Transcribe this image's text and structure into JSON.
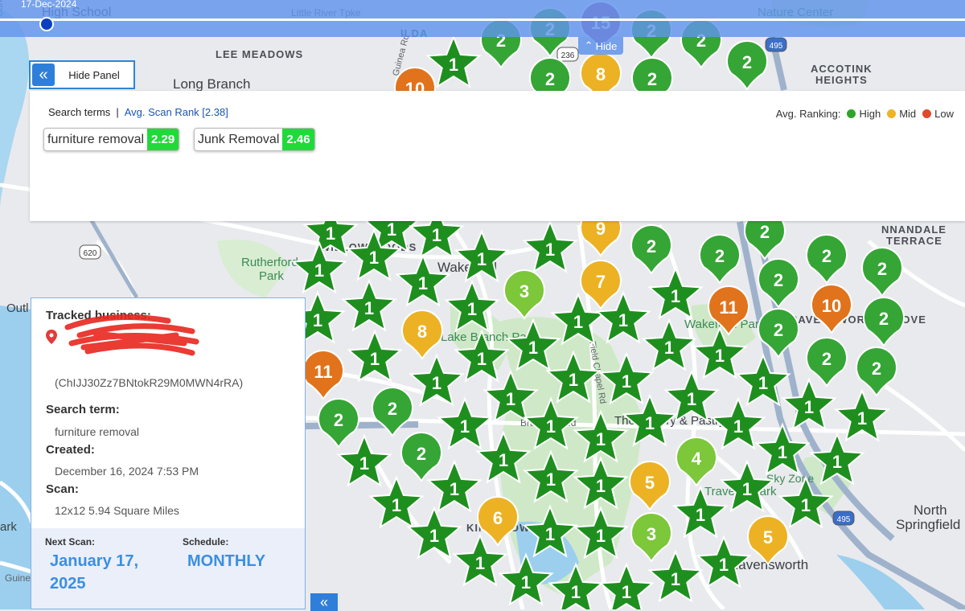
{
  "timeline": {
    "date": "17-Dec-2024",
    "hide_label": "Hide"
  },
  "panel_toggle": {
    "label": "Hide Panel"
  },
  "search_panel": {
    "header_label": "Search terms",
    "separator": "|",
    "avg_rank_label": "Avg. Scan Rank [2.38]",
    "legend": {
      "title": "Avg. Ranking:",
      "items": [
        {
          "label": "High",
          "color": "#2ea52e"
        },
        {
          "label": "Mid",
          "color": "#f0b323"
        },
        {
          "label": "Low",
          "color": "#e04a2a"
        }
      ]
    },
    "terms": [
      {
        "term": "furniture removal",
        "score": "2.29"
      },
      {
        "term": "Junk Removal",
        "score": "2.46"
      }
    ]
  },
  "business_card": {
    "tracked_label": "Tracked business:",
    "place_id": "(ChIJJ30Zz7BNtokR29M0MWN4rRA)",
    "search_term_label": "Search term:",
    "search_term": "furniture removal",
    "created_label": "Created:",
    "created": "December 16, 2024 7:53 PM",
    "scan_label": "Scan:",
    "scan": "12x12 5.94 Square Miles",
    "next_scan_label": "Next Scan:",
    "next_scan_line1": "January 17,",
    "next_scan_line2": "2025",
    "schedule_label": "Schedule:",
    "schedule": "MONTHLY"
  },
  "map": {
    "labels": [
      {
        "text": "High School",
        "cls": "city",
        "size": 16
      },
      {
        "text": "Little River Tpke",
        "cls": "road",
        "size": 12
      },
      {
        "text": "ILDA",
        "cls": "caps",
        "size": 13
      },
      {
        "text": "Nature Center",
        "cls": "park",
        "size": 15
      },
      {
        "text": "LEE MEADOWS",
        "cls": "caps",
        "size": 13
      },
      {
        "text": "Long Branch",
        "cls": "city",
        "size": 17
      },
      {
        "text": "ACCOTINK",
        "cls": "caps",
        "size": 13
      },
      {
        "text": "HEIGHTS",
        "cls": "caps",
        "size": 13
      },
      {
        "text": "Guinea Rd",
        "cls": "road",
        "size": 11
      },
      {
        "text": "WILLOW WOODS",
        "cls": "caps",
        "size": 13
      },
      {
        "text": "Wakefield",
        "cls": "city",
        "size": 17
      },
      {
        "text": "Rutherford",
        "cls": "park",
        "size": 15
      },
      {
        "text": "Park",
        "cls": "park",
        "size": 15
      },
      {
        "text": "Outl",
        "cls": "city",
        "size": 15
      },
      {
        "text": "Lake Branch Park",
        "cls": "park",
        "size": 15
      },
      {
        "text": "Wakefield Park",
        "cls": "park",
        "size": 15
      },
      {
        "text": "RAVENSWORTH GROVE",
        "cls": "caps",
        "size": 13
      },
      {
        "text": "NNANDALE",
        "cls": "caps",
        "size": 13
      },
      {
        "text": "TERRACE",
        "cls": "caps",
        "size": 13
      },
      {
        "text": "The Bakery & Pastry Shop",
        "cls": "city",
        "size": 15
      },
      {
        "text": "Traveler Park",
        "cls": "park",
        "size": 15
      },
      {
        "text": "Sky Zone",
        "cls": "park",
        "size": 14
      },
      {
        "text": "North",
        "cls": "city",
        "size": 17
      },
      {
        "text": "Springfield",
        "cls": "city",
        "size": 17
      },
      {
        "text": "KINGSTOWNE",
        "cls": "caps",
        "size": 13
      },
      {
        "text": "Ravensworth",
        "cls": "city",
        "size": 17
      },
      {
        "text": "ark",
        "cls": "city",
        "size": 15
      },
      {
        "text": "Guine",
        "cls": "road",
        "size": 12
      },
      {
        "text": "Braddock Rd",
        "cls": "road",
        "size": 12
      },
      {
        "text": "Field Chapel Rd",
        "cls": "road",
        "size": 11
      },
      {
        "text": "Burke",
        "cls": "road",
        "size": 11
      }
    ],
    "shields": [
      "236",
      "620",
      "495",
      "495"
    ],
    "markers": [
      {
        "t": "star",
        "n": "1"
      },
      {
        "t": "pin",
        "n": "2"
      },
      {
        "t": "pin",
        "n": "2"
      },
      {
        "t": "pin",
        "n": "15"
      },
      {
        "t": "pin",
        "n": "2"
      },
      {
        "t": "pin",
        "n": "2"
      },
      {
        "t": "pin",
        "n": "2"
      },
      {
        "t": "pin",
        "n": "2"
      },
      {
        "t": "pin",
        "n": "8"
      },
      {
        "t": "pin",
        "n": "2"
      },
      {
        "t": "pin",
        "n": "10"
      },
      {
        "t": "star",
        "n": "1"
      },
      {
        "t": "star",
        "n": "1"
      },
      {
        "t": "star",
        "n": "1"
      },
      {
        "t": "star",
        "n": "1"
      },
      {
        "t": "star",
        "n": "1"
      },
      {
        "t": "pin",
        "n": "9"
      },
      {
        "t": "pin",
        "n": "2"
      },
      {
        "t": "pin",
        "n": "2"
      },
      {
        "t": "pin",
        "n": "2"
      },
      {
        "t": "pin",
        "n": "2"
      },
      {
        "t": "pin",
        "n": "2"
      },
      {
        "t": "star",
        "n": "1"
      },
      {
        "t": "star",
        "n": "1"
      },
      {
        "t": "star",
        "n": "1"
      },
      {
        "t": "pin",
        "n": "3"
      },
      {
        "t": "pin",
        "n": "7"
      },
      {
        "t": "star",
        "n": "1"
      },
      {
        "t": "pin",
        "n": "11"
      },
      {
        "t": "pin",
        "n": "2"
      },
      {
        "t": "pin",
        "n": "10"
      },
      {
        "t": "pin",
        "n": "2"
      },
      {
        "t": "star",
        "n": "1"
      },
      {
        "t": "star",
        "n": "1"
      },
      {
        "t": "pin",
        "n": "8"
      },
      {
        "t": "star",
        "n": "1"
      },
      {
        "t": "star",
        "n": "1"
      },
      {
        "t": "star",
        "n": "1"
      },
      {
        "t": "star",
        "n": "1"
      },
      {
        "t": "star",
        "n": "1"
      },
      {
        "t": "pin",
        "n": "2"
      },
      {
        "t": "pin",
        "n": "2"
      },
      {
        "t": "pin",
        "n": "2"
      },
      {
        "t": "pin",
        "n": "11"
      },
      {
        "t": "star",
        "n": "1"
      },
      {
        "t": "star",
        "n": "1"
      },
      {
        "t": "star",
        "n": "1"
      },
      {
        "t": "star",
        "n": "1"
      },
      {
        "t": "star",
        "n": "1"
      },
      {
        "t": "star",
        "n": "1"
      },
      {
        "t": "star",
        "n": "1"
      },
      {
        "t": "star",
        "n": "1"
      },
      {
        "t": "star",
        "n": "1"
      },
      {
        "t": "pin",
        "n": "2"
      },
      {
        "t": "pin",
        "n": "2"
      },
      {
        "t": "star",
        "n": "1"
      },
      {
        "t": "star",
        "n": "1"
      },
      {
        "t": "star",
        "n": "1"
      },
      {
        "t": "star",
        "n": "1"
      },
      {
        "t": "star",
        "n": "1"
      },
      {
        "t": "star",
        "n": "1"
      },
      {
        "t": "star",
        "n": "1"
      },
      {
        "t": "star",
        "n": "1"
      },
      {
        "t": "star",
        "n": "1"
      },
      {
        "t": "pin",
        "n": "2"
      },
      {
        "t": "star",
        "n": "1"
      },
      {
        "t": "star",
        "n": "1"
      },
      {
        "t": "star",
        "n": "1"
      },
      {
        "t": "pin",
        "n": "5"
      },
      {
        "t": "pin",
        "n": "4"
      },
      {
        "t": "star",
        "n": "1"
      },
      {
        "t": "star",
        "n": "1"
      },
      {
        "t": "star",
        "n": "1"
      },
      {
        "t": "star",
        "n": "1"
      },
      {
        "t": "star",
        "n": "1"
      },
      {
        "t": "pin",
        "n": "6"
      },
      {
        "t": "star",
        "n": "1"
      },
      {
        "t": "star",
        "n": "1"
      },
      {
        "t": "pin",
        "n": "3"
      },
      {
        "t": "star",
        "n": "1"
      },
      {
        "t": "star",
        "n": "1"
      },
      {
        "t": "star",
        "n": "1"
      },
      {
        "t": "star",
        "n": "1"
      },
      {
        "t": "star",
        "n": "1"
      },
      {
        "t": "star",
        "n": "1"
      },
      {
        "t": "star",
        "n": "1"
      },
      {
        "t": "pin",
        "n": "5"
      },
      {
        "t": "star",
        "n": "1"
      }
    ],
    "colors": {
      "star": "#1e8f1e",
      "green": "#35a535",
      "lightgreen": "#7cc73a",
      "yellow": "#ecb224",
      "orange": "#e0731c",
      "red": "#e3552e",
      "purple": "#9c4fa0",
      "water": "#8ec8ee",
      "park": "#c9e8c4",
      "road": "#ffffff",
      "highway": "#8aa3c0"
    }
  }
}
